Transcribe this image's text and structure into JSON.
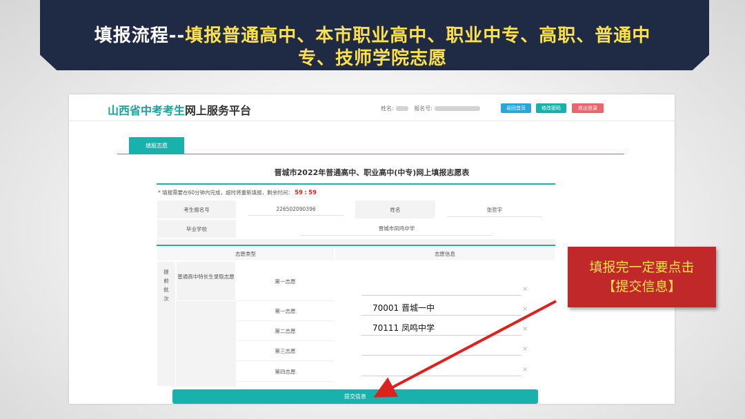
{
  "banner": {
    "title_bold": "填报流程--",
    "title_rest_line1": "填报普通高中、本市职业高中、职业中专、高职、普通中",
    "title_rest_line2": "专、技师学院志愿"
  },
  "header": {
    "logo_green": "山西省中考考生",
    "logo_dark": "网上服务平台",
    "name_label": "姓名:",
    "reg_label": "报名号:",
    "btn_home": "返回首页",
    "btn_pwd": "修改密码",
    "btn_logout": "退出登录"
  },
  "tab_label": "填报志愿",
  "form_title": "晋城市2022年普通高中、职业高中(中专)网上填报志愿表",
  "notice": {
    "text": "* 填报需要在60分钟内完成，超时将重新填报，剩余时间：",
    "timer_min": "59",
    "timer_sep": ":",
    "timer_sec": "59"
  },
  "info": {
    "reg_no_label": "考生报名号",
    "reg_no_value": "226502090396",
    "name_label": "姓名",
    "name_value": "张哲宇",
    "school_label": "毕业学校",
    "school_value": "晋城市凤鸣中学"
  },
  "table": {
    "col_type": "志愿类型",
    "col_info": "志愿信息",
    "batch_label": "提前批次",
    "special_label": "普通高中特长生录取志愿",
    "rows": [
      {
        "label": "第一志愿",
        "value": ""
      },
      {
        "label": "第一志愿",
        "value": "70001 晋城一中"
      },
      {
        "label": "第二志愿",
        "value": "70111 凤鸣中学"
      },
      {
        "label": "第三志愿",
        "value": ""
      },
      {
        "label": "第四志愿",
        "value": ""
      }
    ],
    "clear_symbol": "×"
  },
  "submit_label": "提交信息",
  "callout": {
    "line1": "填报完一定要点击",
    "line2": "【提交信息】"
  },
  "colors": {
    "teal": "#19b1ac",
    "callout_bg": "#c0282a",
    "callout_text": "#ffe24a",
    "banner_bg": "#1f2a44"
  }
}
